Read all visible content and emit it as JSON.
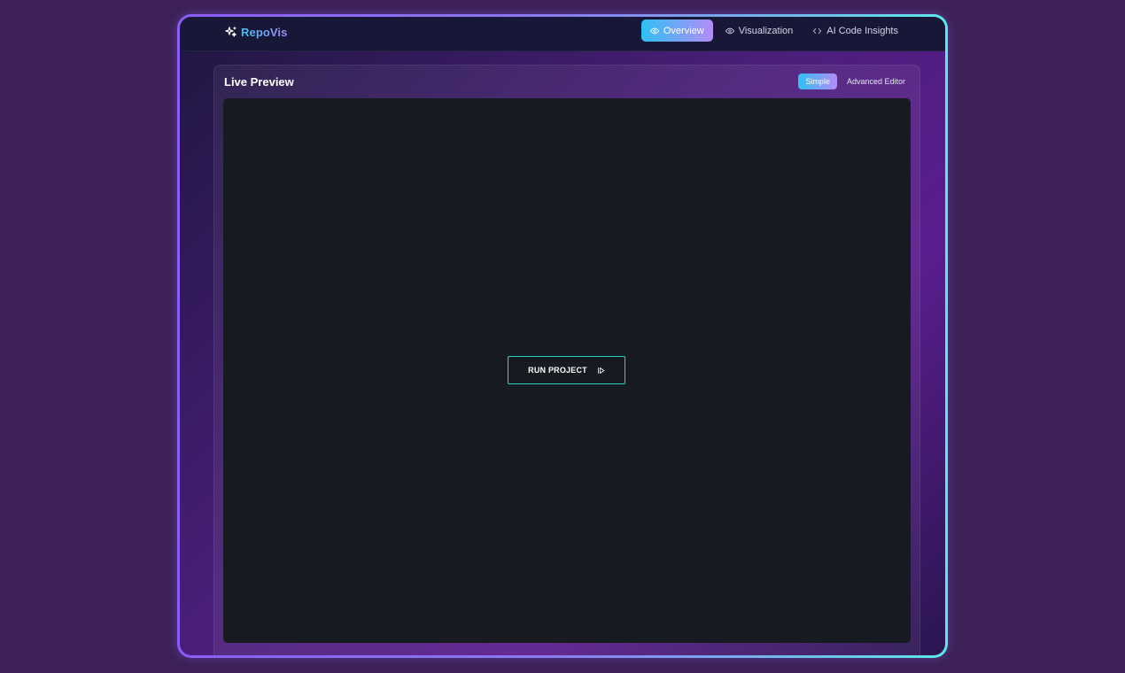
{
  "app": {
    "name": "RepoVis",
    "logo_icon": "sparkles-icon"
  },
  "nav": {
    "items": [
      {
        "label": "Overview",
        "icon": "eye-icon",
        "active": true
      },
      {
        "label": "Visualization",
        "icon": "eye-icon",
        "active": false
      },
      {
        "label": "AI Code Insights",
        "icon": "code-icon",
        "active": false
      }
    ]
  },
  "panel": {
    "title": "Live Preview",
    "modes": [
      {
        "label": "Simple",
        "active": true
      },
      {
        "label": "Advanced Editor",
        "active": false
      }
    ],
    "run_button": {
      "label": "RUN PROJECT",
      "icon": "step-forward-icon"
    }
  },
  "colors": {
    "background": "#3d2158",
    "topbar": "#171737",
    "accent_start": "#2fc0f2",
    "accent_end": "#b48cf7",
    "preview_bg": "#171a21",
    "run_border": "#2dd4bf"
  }
}
